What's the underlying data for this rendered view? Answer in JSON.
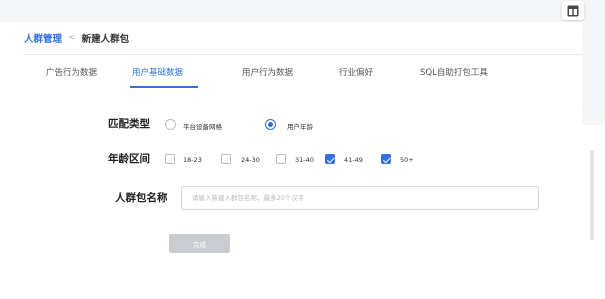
{
  "breadcrumb": {
    "root": "人群管理",
    "separator": "<",
    "current": "新建人群包"
  },
  "tabs": [
    {
      "label": "广告行为数据",
      "active": false
    },
    {
      "label": "用户基础数据",
      "active": true
    },
    {
      "label": "用户行为数据",
      "active": false
    },
    {
      "label": "行业偏好",
      "active": false
    },
    {
      "label": "SQL自助打包工具",
      "active": false
    }
  ],
  "match_type": {
    "label": "匹配类型",
    "options": [
      {
        "label": "平台设备网格",
        "checked": false
      },
      {
        "label": "用户年龄",
        "checked": true
      }
    ]
  },
  "age_range": {
    "label": "年龄区间",
    "options": [
      {
        "label": "18-23",
        "checked": false
      },
      {
        "label": "24-30",
        "checked": false
      },
      {
        "label": "31-40",
        "checked": false
      },
      {
        "label": "41-49",
        "checked": true
      },
      {
        "label": "50+",
        "checked": true
      }
    ]
  },
  "package_name": {
    "label": "人群包名称",
    "placeholder": "请输入新建人群包名称，最多20个汉字",
    "value": ""
  },
  "submit_label": "完成",
  "colors": {
    "accent": "#2f6fde",
    "disabled_button": "#c9ccd1"
  },
  "icons": {
    "corner": "table-icon"
  }
}
